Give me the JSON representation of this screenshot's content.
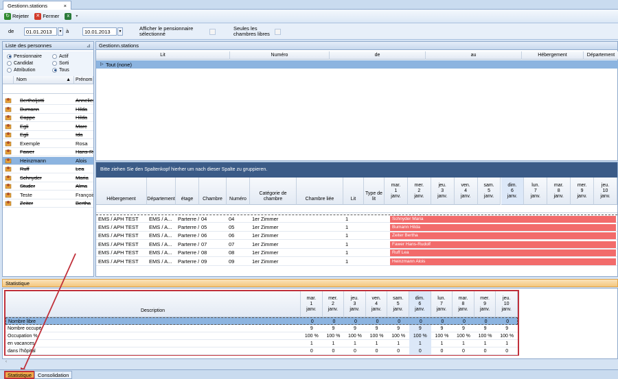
{
  "window": {
    "tab_title": "Gestionn.stations",
    "close_glyph": "×"
  },
  "toolbar": {
    "reject_label": "Rejeter",
    "close_label": "Fermer"
  },
  "filters": {
    "from_label": "de",
    "from_value": "01.01.2013",
    "to_label": "à",
    "to_value": "10.01.2013",
    "show_resident_label": "Afficher le pensionnaire sélectionné",
    "free_rooms_label": "Seules les chambres libres"
  },
  "persons": {
    "title": "Liste des personnes",
    "radios": [
      {
        "label": "Pensionnaire",
        "on": true
      },
      {
        "label": "Actif",
        "on": false
      },
      {
        "label": "Candidat",
        "on": false
      },
      {
        "label": "Sorti",
        "on": false
      },
      {
        "label": "Attribution",
        "on": false
      },
      {
        "label": "Tous",
        "on": true
      }
    ],
    "col_nom": "Nom",
    "col_prenom": "Prénom",
    "rows": [
      {
        "nom": "Bertholjotti",
        "prenom": "Anneliese",
        "strike": true
      },
      {
        "nom": "Bumann",
        "prenom": "Hilda",
        "strike": true
      },
      {
        "nom": "Cappe",
        "prenom": "Hilda",
        "strike": true
      },
      {
        "nom": "Egli",
        "prenom": "Marc",
        "strike": true
      },
      {
        "nom": "Egli",
        "prenom": "Ida",
        "strike": true
      },
      {
        "nom": "Exemple",
        "prenom": "Rosa",
        "strike": false
      },
      {
        "nom": "Fawer",
        "prenom": "Hans-Rudolf",
        "strike": true
      },
      {
        "nom": "Heinzmann",
        "prenom": "Alois",
        "strike": false,
        "selected": true
      },
      {
        "nom": "Ruff",
        "prenom": "Lea",
        "strike": true
      },
      {
        "nom": "Schnyder",
        "prenom": "Maria",
        "strike": true
      },
      {
        "nom": "Studer",
        "prenom": "Alma",
        "strike": true
      },
      {
        "nom": "Teste",
        "prenom": "François",
        "strike": false
      },
      {
        "nom": "Zeiter",
        "prenom": "Bertha",
        "strike": true
      }
    ]
  },
  "top_grid": {
    "title": "Gestionn.stations",
    "columns": [
      "Lit",
      "Numéro",
      "de",
      "au",
      "Hébergement",
      "Département"
    ],
    "group_row": "Tout  (none)"
  },
  "group_hint": "Bitte ziehen Sie den Spaltenkopf hierher um nach dieser Spalte zu gruppieren.",
  "plan": {
    "columns": [
      "Hébergement",
      "Département",
      "étage",
      "Chambre",
      "Numéro",
      "Catégorie de chambre",
      "Chambre liée",
      "Lit",
      "Type de lit"
    ],
    "days": [
      {
        "d": "mar.",
        "n": "1",
        "m": "janv."
      },
      {
        "d": "mer.",
        "n": "2",
        "m": "janv."
      },
      {
        "d": "jeu.",
        "n": "3",
        "m": "janv."
      },
      {
        "d": "ven.",
        "n": "4",
        "m": "janv."
      },
      {
        "d": "sam.",
        "n": "5",
        "m": "janv."
      },
      {
        "d": "dim.",
        "n": "6",
        "m": "janv."
      },
      {
        "d": "lun.",
        "n": "7",
        "m": "janv."
      },
      {
        "d": "mar.",
        "n": "8",
        "m": "janv."
      },
      {
        "d": "mer.",
        "n": "9",
        "m": "janv."
      },
      {
        "d": "jeu.",
        "n": "10",
        "m": "janv."
      }
    ],
    "rows": [
      {
        "heb": "EMS / APH TEST",
        "dep": "EMS / A...",
        "etage": "Parterre /...",
        "ch": "04",
        "num": "04",
        "cat": "1er Zimmer",
        "lit": "1",
        "occupant": "Schnyder Maria"
      },
      {
        "heb": "EMS / APH TEST",
        "dep": "EMS / A...",
        "etage": "Parterre /...",
        "ch": "05",
        "num": "05",
        "cat": "1er Zimmer",
        "lit": "1",
        "occupant": "Bumann Hilda"
      },
      {
        "heb": "EMS / APH TEST",
        "dep": "EMS / A...",
        "etage": "Parterre /...",
        "ch": "06",
        "num": "06",
        "cat": "1er Zimmer",
        "lit": "1",
        "occupant": "Zeiter Bertha"
      },
      {
        "heb": "EMS / APH TEST",
        "dep": "EMS / A...",
        "etage": "Parterre /...",
        "ch": "07",
        "num": "07",
        "cat": "1er Zimmer",
        "lit": "1",
        "occupant": "Fawer Hans-Rudolf"
      },
      {
        "heb": "EMS / APH TEST",
        "dep": "EMS / A...",
        "etage": "Parterre /...",
        "ch": "08",
        "num": "08",
        "cat": "1er Zimmer",
        "lit": "1",
        "occupant": "Ruff Lea"
      },
      {
        "heb": "EMS / APH TEST",
        "dep": "EMS / A...",
        "etage": "Parterre /...",
        "ch": "09",
        "num": "09",
        "cat": "1er Zimmer",
        "lit": "1",
        "occupant": "Heinzmann Alois"
      }
    ]
  },
  "stats": {
    "title": "Statistique",
    "desc_header": "Description",
    "rows": [
      {
        "label": "Nombre libre",
        "values": [
          "0",
          "0",
          "0",
          "0",
          "0",
          "0",
          "0",
          "0",
          "0",
          "0"
        ]
      },
      {
        "label": "Nombre occupé",
        "values": [
          "9",
          "9",
          "9",
          "9",
          "9",
          "9",
          "9",
          "9",
          "9",
          "9"
        ]
      },
      {
        "label": "Occupation %",
        "values": [
          "100 %",
          "100 %",
          "100 %",
          "100 %",
          "100 %",
          "100 %",
          "100 %",
          "100 %",
          "100 %",
          "100 %"
        ]
      },
      {
        "label": "en vacances",
        "values": [
          "1",
          "1",
          "1",
          "1",
          "1",
          "1",
          "1",
          "1",
          "1",
          "1"
        ]
      },
      {
        "label": "dans l'hôpital",
        "values": [
          "0",
          "0",
          "0",
          "0",
          "0",
          "0",
          "0",
          "0",
          "0",
          "0"
        ]
      }
    ]
  },
  "bottom_tabs": [
    "Statistique",
    "Consolidation"
  ],
  "colors": {
    "bar": "#f26b6b",
    "highlight": "#e36c09",
    "band": "#3b5b87"
  }
}
